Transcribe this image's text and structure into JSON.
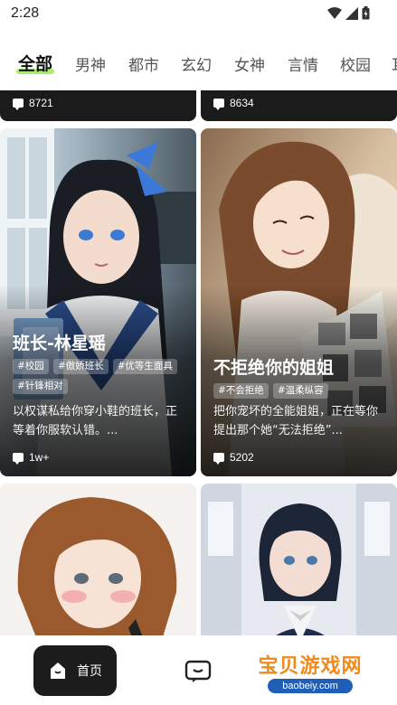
{
  "status_bar": {
    "time": "2:28"
  },
  "tabs": [
    "全部",
    "男神",
    "都市",
    "玄幻",
    "女神",
    "言情",
    "校园",
    "耳"
  ],
  "top_cards": [
    {
      "count": "8721"
    },
    {
      "count": "8634"
    }
  ],
  "cards": [
    {
      "title": "班长-林星瑶",
      "tags": [
        "#校园",
        "#傲娇班长",
        "#优等生面具",
        "#针锋相对"
      ],
      "description": "以权谋私给你穿小鞋的班长，正等着你服软认错。...",
      "count": "1w+"
    },
    {
      "title": "不拒绝你的姐姐",
      "tags": [
        "#不会拒绝",
        "#温柔纵容"
      ],
      "description": "把你宠坏的全能姐姐，正在等你提出那个她“无法拒绝”...",
      "count": "5202"
    }
  ],
  "bottom_nav": {
    "home_label": "首页"
  },
  "watermark": {
    "text": "宝贝游戏网",
    "url": "baobeiy.com"
  }
}
